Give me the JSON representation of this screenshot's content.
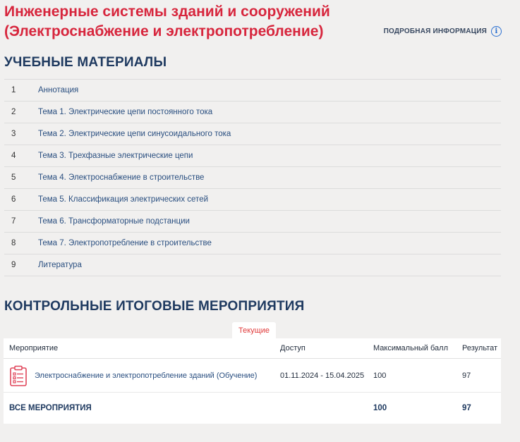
{
  "page": {
    "title": "Инженерные системы зданий и сооружений (Электроснабжение и электропотребление)",
    "more_info": "ПОДРОБНАЯ ИНФОРМАЦИЯ",
    "info_icon": "i"
  },
  "materials": {
    "heading": "УЧЕБНЫЕ МАТЕРИАЛЫ",
    "items": [
      {
        "num": "1",
        "label": "Аннотация"
      },
      {
        "num": "2",
        "label": "Тема 1. Электрические цепи постоянного тока"
      },
      {
        "num": "3",
        "label": "Тема 2. Электрические цепи синусоидального тока"
      },
      {
        "num": "4",
        "label": "Тема 3. Трехфазные электрические цепи"
      },
      {
        "num": "5",
        "label": "Тема 4. Электроснабжение в строительстве"
      },
      {
        "num": "6",
        "label": "Тема 5. Классификация электрических сетей"
      },
      {
        "num": "7",
        "label": "Тема 6. Трансформаторные подстанции"
      },
      {
        "num": "8",
        "label": "Тема 7. Электропотребление в строительстве"
      },
      {
        "num": "9",
        "label": "Литература"
      }
    ]
  },
  "events": {
    "heading": "КОНТРОЛЬНЫЕ ИТОГОВЫЕ МЕРОПРИЯТИЯ",
    "tab": "Текущие",
    "columns": {
      "event": "Мероприятие",
      "access": "Доступ",
      "max_score": "Максимальный балл",
      "result": "Результат"
    },
    "rows": [
      {
        "icon": "clipboard-list-icon",
        "name": "Электроснабжение и электропотребление зданий (Обучение)",
        "access": "01.11.2024 - 15.04.2025",
        "max_score": "100",
        "result": "97"
      }
    ],
    "total": {
      "label": "ВСЕ МЕРОПРИЯТИЯ",
      "max_score": "100",
      "result": "97"
    }
  },
  "colors": {
    "title": "#d7263d",
    "heading": "#1f3a60",
    "link": "#2a4f80",
    "tab_active": "#e03a3a",
    "info_icon": "#2a6fd1",
    "background": "#f1f0ef"
  }
}
